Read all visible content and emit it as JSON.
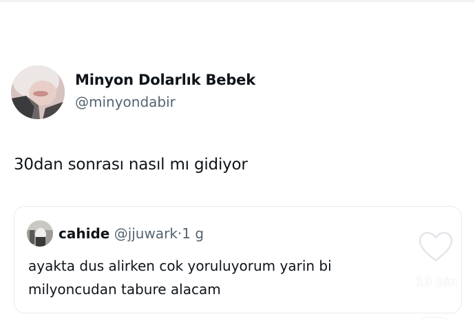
{
  "tweet": {
    "author": {
      "display_name": "Minyon Dolarlık Bebek",
      "handle": "@minyondabir"
    },
    "text": "30dan sonrası nasıl mı gidiyor"
  },
  "quoted_tweet": {
    "author": {
      "display_name": "cahide",
      "handle": "@jjuwark"
    },
    "separator": "·",
    "time": "1 g",
    "text": "ayakta dus alirken cok yoruluyorum yarin bi milyoncudan tabure alacam"
  },
  "like_overlay": {
    "icon": "heart-icon",
    "count": "13 bin"
  },
  "colors": {
    "text_primary": "#0f1419",
    "text_secondary": "#536471",
    "card_border": "#e6e9ec",
    "background": "#ffffff"
  }
}
